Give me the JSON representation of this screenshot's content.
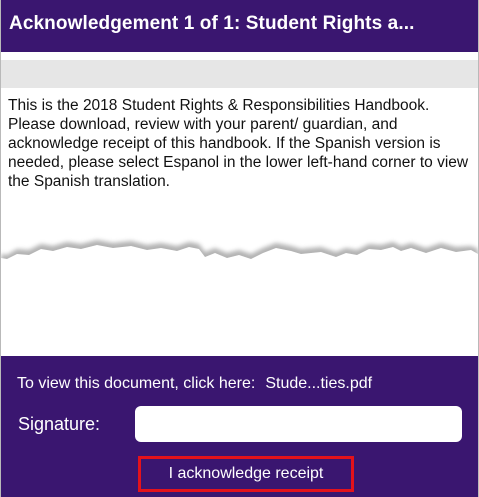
{
  "header": {
    "title": "Acknowledgement 1 of 1: Student Rights a..."
  },
  "document": {
    "body_text": "This is the 2018 Student Rights & Responsibilities Handbook.  Please download, review with your parent/ guardian, and acknowledge receipt of this handbook.  If the Spanish version is needed, please select Espanol in the lower left-hand corner to view the Spanish translation."
  },
  "footer": {
    "view_label": "To view this document, click here:",
    "file_link": "Stude...ties.pdf",
    "signature_label": "Signature:",
    "signature_value": "",
    "acknowledge_button": "I acknowledge receipt"
  },
  "colors": {
    "brand_purple": "#3a1670",
    "highlight_red": "#e4121b",
    "gray_bar": "#e6e6e6"
  }
}
